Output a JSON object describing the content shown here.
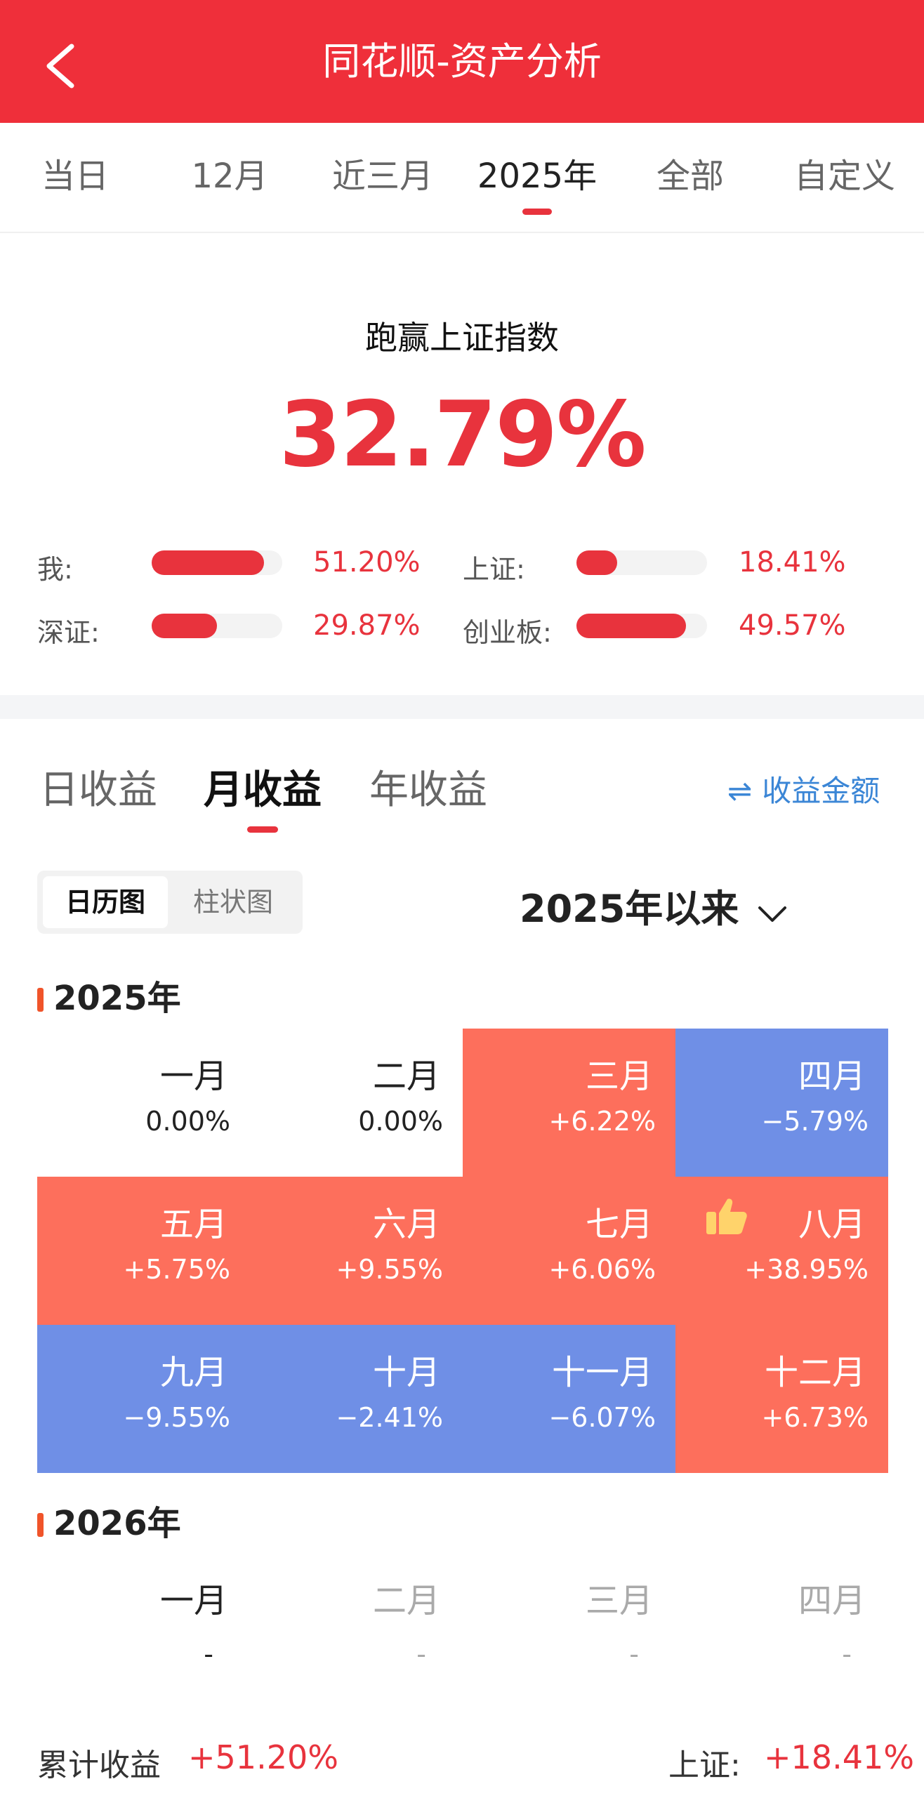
{
  "header": {
    "title": "同花顺-资产分析"
  },
  "period_tabs": [
    "当日",
    "12月",
    "近三月",
    "2025年",
    "全部",
    "自定义"
  ],
  "period_active": "2025年",
  "beat": {
    "title": "跑赢上证指数",
    "value": "32.79%",
    "items": [
      {
        "label": "我:",
        "value": "51.20%",
        "ratio": 0.86
      },
      {
        "label": "上证:",
        "value": "18.41%",
        "ratio": 0.31
      },
      {
        "label": "深证:",
        "value": "29.87%",
        "ratio": 0.5
      },
      {
        "label": "创业板:",
        "value": "49.57%",
        "ratio": 0.84
      }
    ]
  },
  "income_tabs": [
    "日收益",
    "月收益",
    "年收益"
  ],
  "income_active": "月收益",
  "amount_toggle": "收益金额",
  "view_switch": [
    "日历图",
    "柱状图"
  ],
  "view_active": "日历图",
  "range": "2025年以来",
  "years": [
    {
      "label": "2025年",
      "months": [
        {
          "name": "一月",
          "value": "0.00%",
          "trend": "flat"
        },
        {
          "name": "二月",
          "value": "0.00%",
          "trend": "flat"
        },
        {
          "name": "三月",
          "value": "+6.22%",
          "trend": "up"
        },
        {
          "name": "四月",
          "value": "−5.79%",
          "trend": "down"
        },
        {
          "name": "五月",
          "value": "+5.75%",
          "trend": "up"
        },
        {
          "name": "六月",
          "value": "+9.55%",
          "trend": "up"
        },
        {
          "name": "七月",
          "value": "+6.06%",
          "trend": "up"
        },
        {
          "name": "八月",
          "value": "+38.95%",
          "trend": "up",
          "icon": "thumbs-up-icon"
        },
        {
          "name": "九月",
          "value": "−9.55%",
          "trend": "down"
        },
        {
          "name": "十月",
          "value": "−2.41%",
          "trend": "down"
        },
        {
          "name": "十一月",
          "value": "−6.07%",
          "trend": "down"
        },
        {
          "name": "十二月",
          "value": "+6.73%",
          "trend": "up"
        }
      ]
    },
    {
      "label": "2026年",
      "months": [
        {
          "name": "一月",
          "value": "-",
          "trend": "none"
        },
        {
          "name": "二月",
          "value": "-",
          "trend": "empty"
        },
        {
          "name": "三月",
          "value": "-",
          "trend": "empty"
        },
        {
          "name": "四月",
          "value": "-",
          "trend": "empty"
        }
      ]
    }
  ],
  "footer": {
    "cum_label": "累计收益",
    "cum_value": "+51.20%",
    "idx_label": "上证:",
    "idx_value": "+18.41%"
  },
  "colors": {
    "brand": "#ef2f3a",
    "gain": "#fd6f5c",
    "loss": "#6f8fe6",
    "link": "#3b86d6"
  }
}
